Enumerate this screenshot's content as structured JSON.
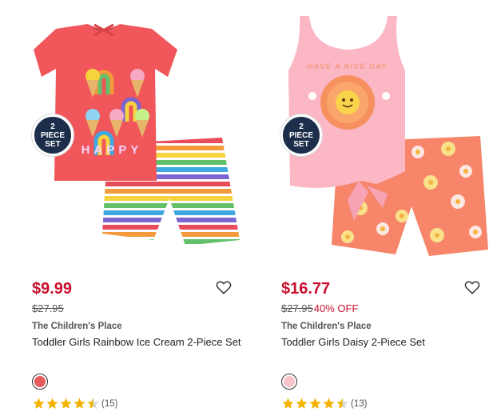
{
  "products": [
    {
      "badge_lines": [
        "2",
        "PIECE",
        "SET"
      ],
      "price": "$9.99",
      "was_price": "$27.95",
      "discount": "",
      "brand": "The Children's Place",
      "title": "Toddler Girls Rainbow Ice Cream 2-Piece Set",
      "swatch_color": "#e85a5e",
      "rating": 4.5,
      "review_count": "(15)",
      "image_text": "HAPPY"
    },
    {
      "badge_lines": [
        "2",
        "PIECE",
        "SET"
      ],
      "price": "$16.77",
      "was_price": "$27.95",
      "discount": "40% OFF",
      "brand": "The Children's Place",
      "title": "Toddler Girls Daisy 2-Piece Set",
      "swatch_color": "#f7c3c7",
      "rating": 4.5,
      "review_count": "(13)",
      "image_text": "HAVE A NICE DAY"
    }
  ],
  "colors": {
    "sale": "#c8102e",
    "star": "#f5b301",
    "badge": "#1c2e4a"
  }
}
